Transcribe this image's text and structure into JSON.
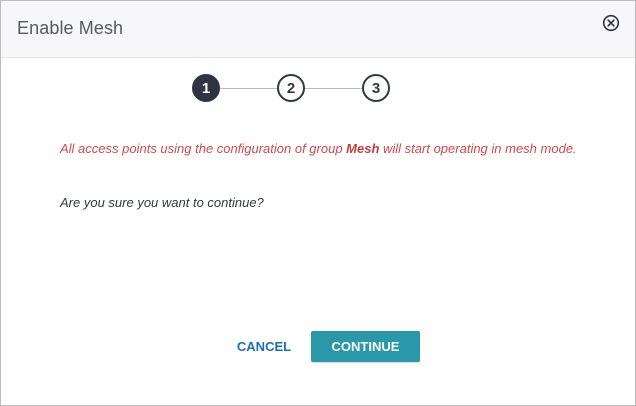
{
  "dialog": {
    "title": "Enable Mesh",
    "close_icon": "close-circle-icon"
  },
  "stepper": {
    "current_step": 1,
    "steps": [
      {
        "label": "1",
        "state": "active"
      },
      {
        "label": "2",
        "state": "pending"
      },
      {
        "label": "3",
        "state": "pending"
      }
    ]
  },
  "message": {
    "warning_prefix": "All access points using the configuration of group ",
    "group_name": "Mesh",
    "warning_suffix": " will start operating in mesh mode.",
    "question": "Are you sure you want to continue?"
  },
  "buttons": {
    "cancel": "CANCEL",
    "continue": "CONTINUE"
  },
  "colors": {
    "warning_text": "#d24a4a",
    "primary_button": "#2a98a8",
    "cancel_link": "#1e6eb6",
    "active_step": "#2f3440"
  }
}
